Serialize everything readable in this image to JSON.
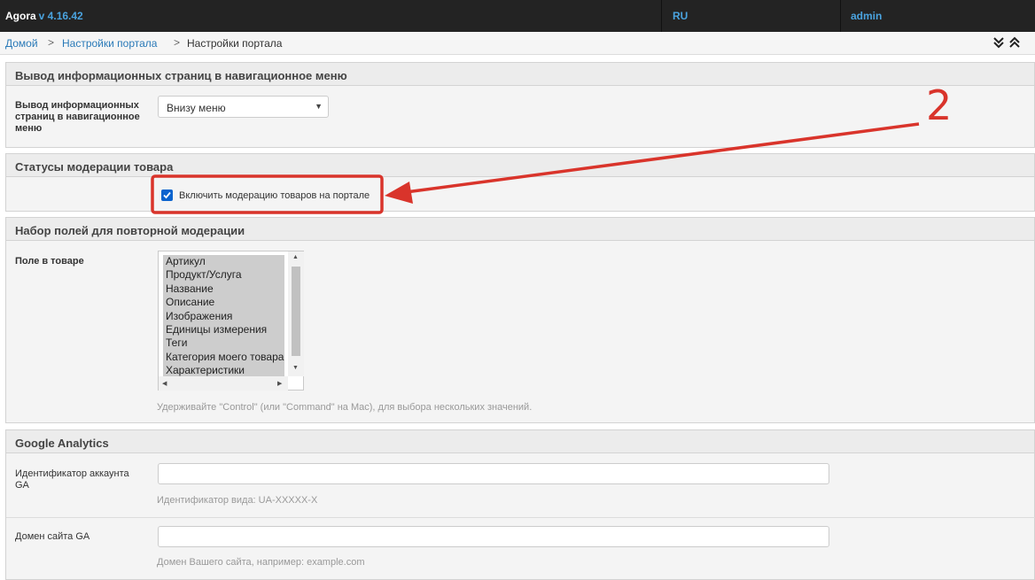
{
  "topbar": {
    "brand": "Agora",
    "version": "v 4.16.42",
    "language": "RU",
    "user": "admin"
  },
  "breadcrumb": {
    "items": [
      "Домой",
      "Настройки портала",
      "Настройки портала"
    ],
    "separator": ">"
  },
  "sections": {
    "nav_pages": {
      "title": "Вывод информационных страниц в навигационное меню",
      "field_label": "Вывод информационных страниц в навигационное меню",
      "select_value": "Внизу меню"
    },
    "moderation": {
      "title": "Статусы модерации товара",
      "checkbox_label": "Включить модерацию товаров на портале",
      "checked": true
    },
    "remoderation": {
      "title": "Набор полей для повторной модерации",
      "field_label": "Поле в товаре",
      "options": [
        "Артикул",
        "Продукт/Услуга",
        "Название",
        "Описание",
        "Изображения",
        "Единицы измерения",
        "Теги",
        "Категория моего товара",
        "Характеристики"
      ],
      "help": "Удерживайте \"Control\" (или \"Command\" на Mac), для выбора нескольких значений."
    },
    "analytics": {
      "title": "Google Analytics",
      "account_label": "Идентификатор аккаунта GA",
      "account_value": "",
      "account_help": "Идентификатор вида: UA-XXXXX-X",
      "domain_label": "Домен сайта GA",
      "domain_value": "",
      "domain_help": "Домен Вашего сайта, например: example.com"
    }
  },
  "annotation": {
    "number": "2",
    "color": "#d9342b"
  },
  "colors": {
    "topbar_bg": "#232323",
    "accent": "#4aa3df",
    "link": "#2a7ab8",
    "checkbox": "#0b63ce"
  }
}
